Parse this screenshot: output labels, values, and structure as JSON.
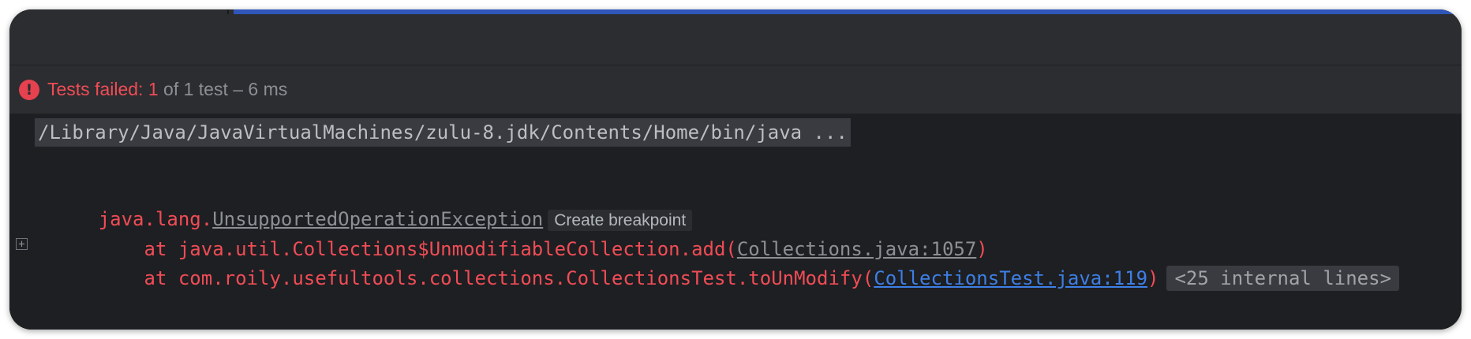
{
  "status": {
    "icon": "error-circle-icon",
    "failed_label": "Tests failed: 1",
    "rest_label": " of 1 test – 6 ms"
  },
  "console": {
    "command": "/Library/Java/JavaVirtualMachines/zulu-8.jdk/Contents/Home/bin/java ...",
    "exception_prefix": "java.lang.",
    "exception_class": "UnsupportedOperationException",
    "create_breakpoint": "Create breakpoint",
    "frames": [
      {
        "prefix": "    at java.util.Collections$UnmodifiableCollection.add(",
        "link": "Collections.java:1057",
        "suffix": ")"
      },
      {
        "prefix": "    at com.roily.usefultools.collections.CollectionsTest.toUnModify(",
        "link": "CollectionsTest.java:119",
        "suffix": ")",
        "folded": "<25 internal lines>"
      }
    ]
  },
  "colors": {
    "error": "#f14c56",
    "link": "#3d7fe6",
    "background": "#1e1f22"
  }
}
